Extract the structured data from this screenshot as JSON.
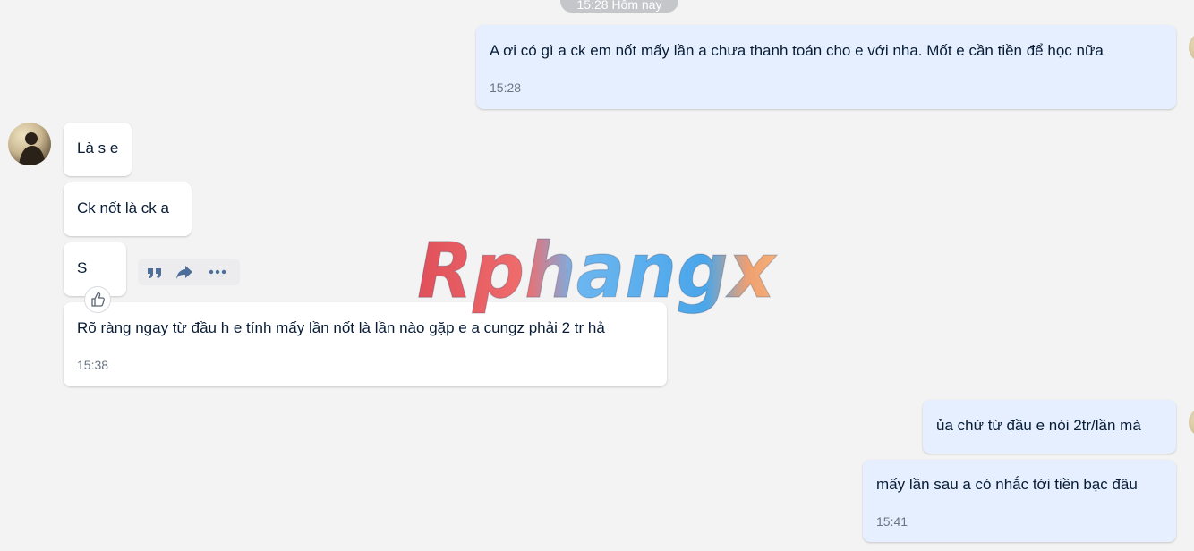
{
  "date_separator": "15:28 Hôm nay",
  "watermark": "Rphangx",
  "messages": [
    {
      "direction": "out",
      "text": "A ơi có gì a ck em nốt mấy lần a chưa thanh toán cho e với nha. Mốt e cần tiền để học nữa",
      "time": "15:28"
    },
    {
      "direction": "in",
      "text": "Là s e"
    },
    {
      "direction": "in",
      "text": "Ck nốt là ck a"
    },
    {
      "direction": "in",
      "text": "S"
    },
    {
      "direction": "in",
      "text": "Rõ ràng ngay từ đầu h e tính mấy lần nốt là lần nào gặp e a cungz phải 2 tr hả",
      "time": "15:38"
    },
    {
      "direction": "out",
      "text": "ủa chứ từ đầu e nói 2tr/lần mà"
    },
    {
      "direction": "out",
      "text": "mấy lần sau a có nhắc tới tiền bạc đâu",
      "time": "15:41"
    }
  ],
  "message_actions": [
    {
      "icon": "quote-icon"
    },
    {
      "icon": "share-icon"
    },
    {
      "icon": "more-icon"
    }
  ],
  "reaction": {
    "icon": "thumbs-up-icon"
  },
  "colors": {
    "background": "#f3f3f3",
    "outgoing_bubble": "#e5efff",
    "incoming_bubble": "#ffffff",
    "text": "#081c36",
    "time": "#6b7480"
  }
}
